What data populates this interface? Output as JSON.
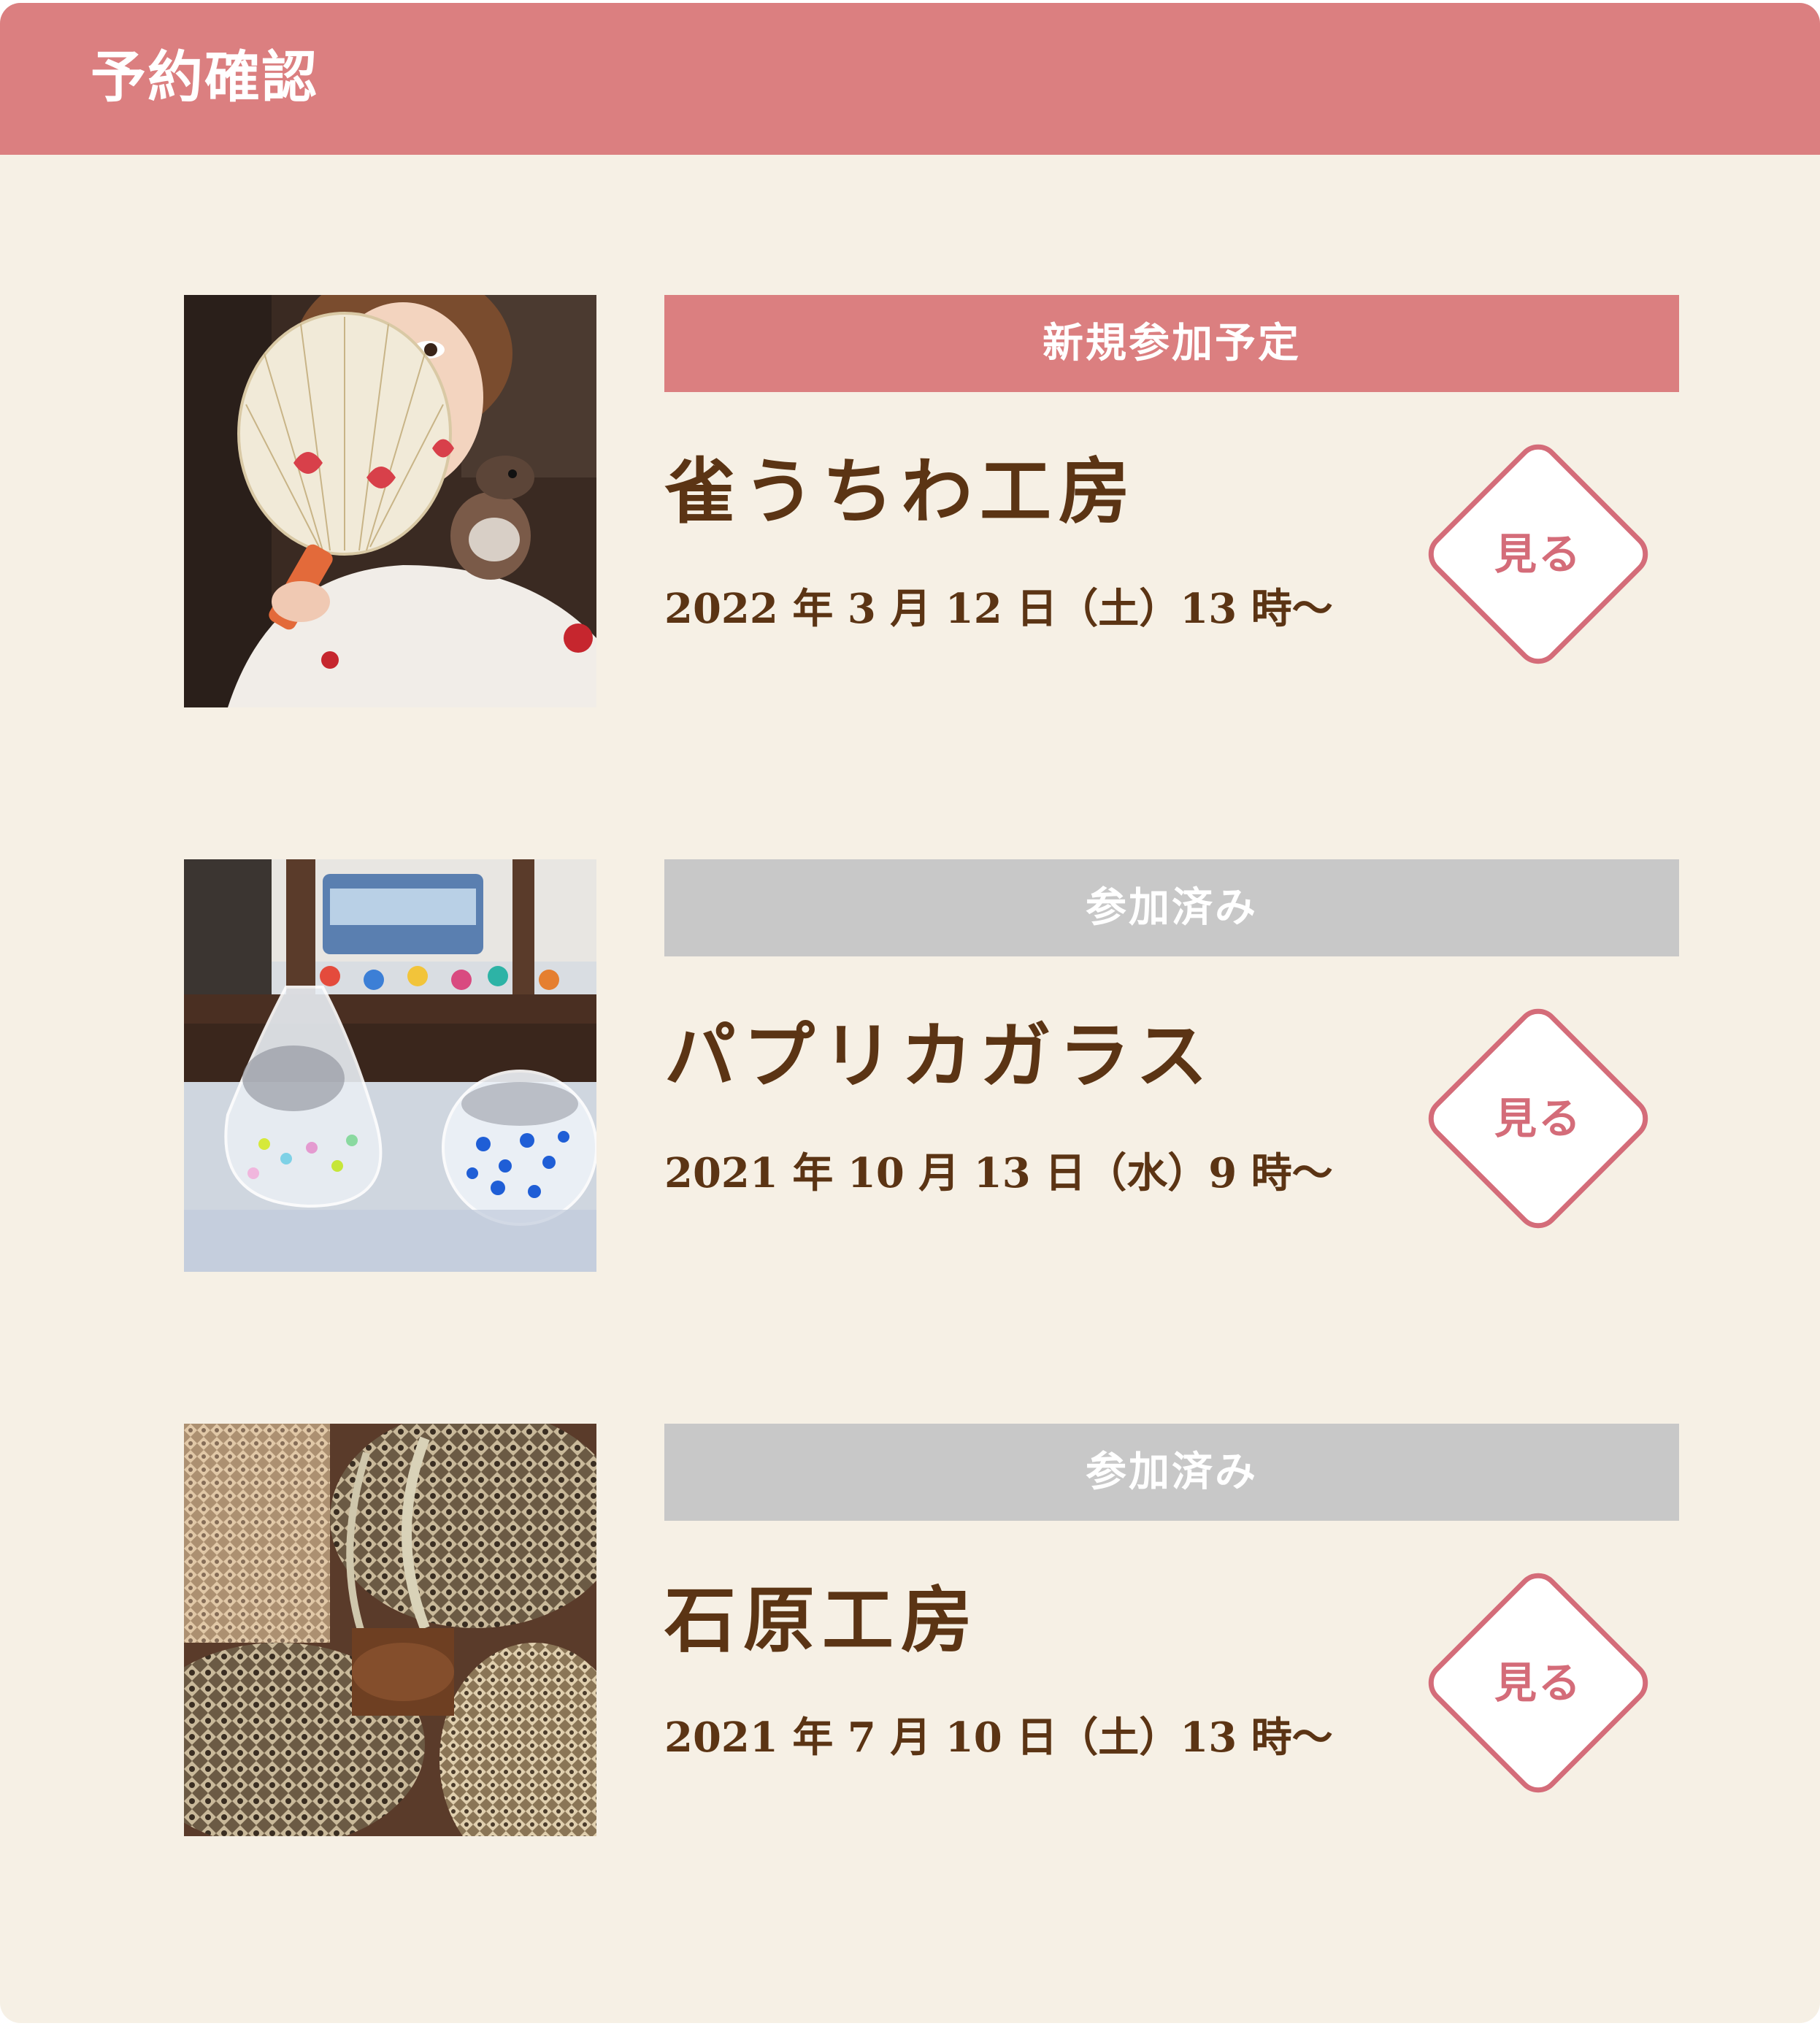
{
  "header": {
    "title": "予約確認"
  },
  "view_label": "見る",
  "items": [
    {
      "status": "新規参加予定",
      "status_type": "new",
      "name": "雀うちわ工房",
      "date": "2022 年 3 月 12 日（土）13 時～"
    },
    {
      "status": "参加済み",
      "status_type": "done",
      "name": "パプリカガラス",
      "date": "2021 年 10 月 13 日（水）9 時～"
    },
    {
      "status": "参加済み",
      "status_type": "done",
      "name": "石原工房",
      "date": "2021 年 7 月 10 日（土）13 時～"
    }
  ],
  "colors": {
    "accent": "#db7f80",
    "button_accent": "#d46c79",
    "done_badge": "#c8c8c8",
    "text_brown": "#5b3414",
    "background": "#f6f0e5"
  }
}
